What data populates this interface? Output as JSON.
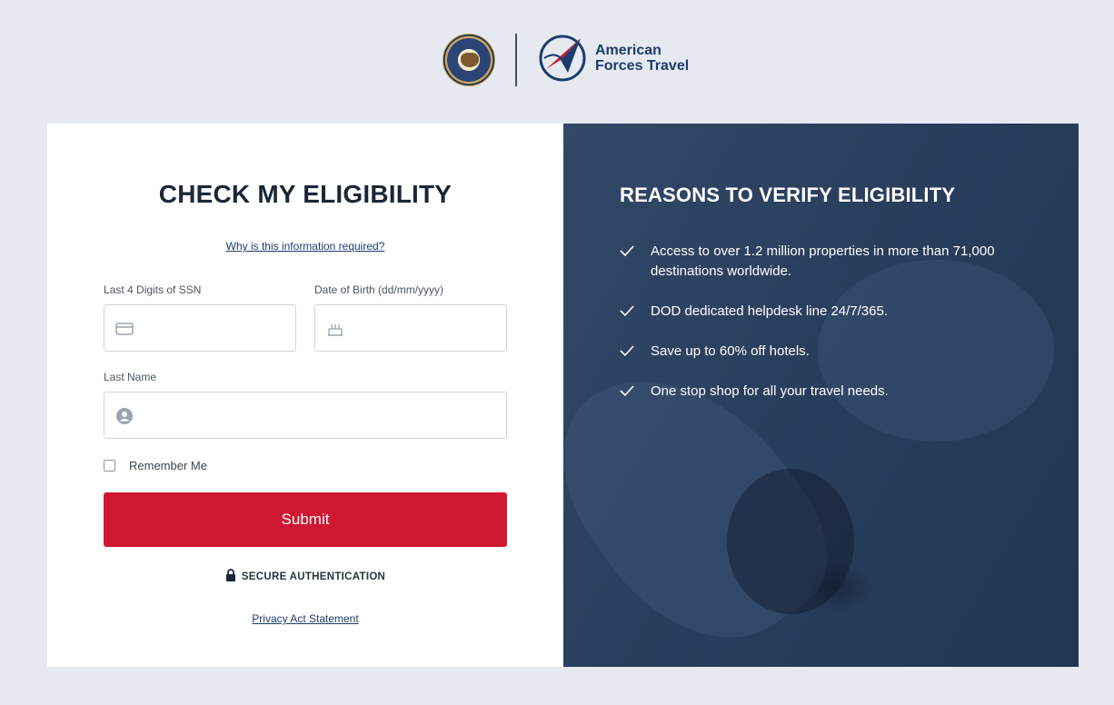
{
  "brand": {
    "line1": "American",
    "line2": "Forces Travel",
    "seal_icon": "dod-seal-icon",
    "logo_icon": "american-forces-travel-logo-icon",
    "brand_color": "#1d3c6d"
  },
  "form": {
    "title": "CHECK MY ELIGIBILITY",
    "why_link": "Why is this information required?",
    "ssn_label": "Last 4 Digits of SSN",
    "dob_label": "Date of Birth (dd/mm/yyyy)",
    "last_name_label": "Last Name",
    "ssn_value": "",
    "dob_value": "",
    "last_name_value": "",
    "remember_label": "Remember Me",
    "remember_checked": false,
    "submit_label": "Submit",
    "secure_label": "SECURE AUTHENTICATION",
    "privacy_link": "Privacy Act Statement",
    "accent_color": "#cf1731"
  },
  "reasons": {
    "title": "REASONS TO VERIFY ELIGIBILITY",
    "items": [
      "Access to over 1.2 million properties in more than 71,000 destinations worldwide.",
      "DOD dedicated helpdesk line 24/7/365.",
      "Save up to 60% off hotels.",
      "One stop shop for all your travel needs."
    ]
  }
}
